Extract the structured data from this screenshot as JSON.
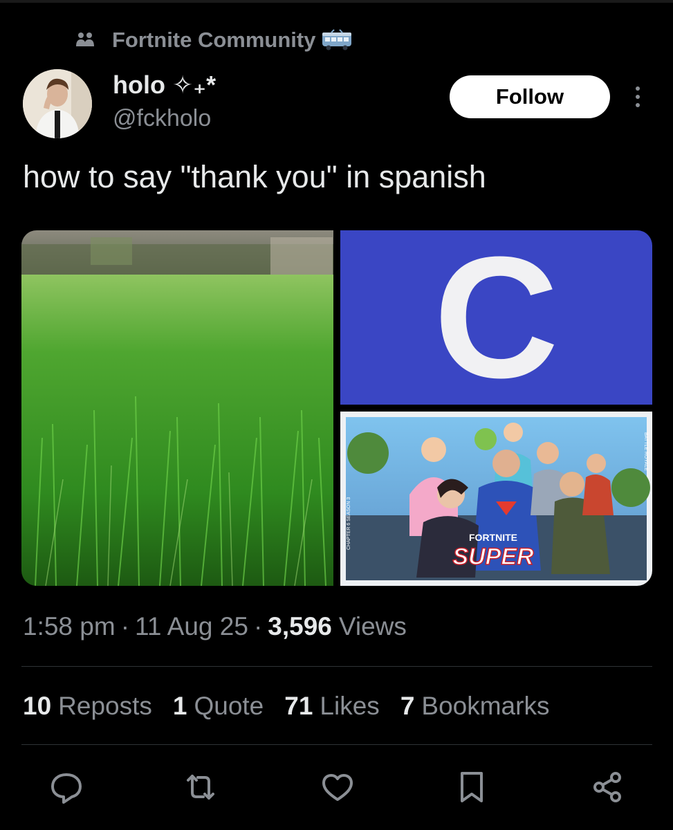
{
  "community": {
    "name": "Fortnite Community",
    "icon": "people-icon",
    "badge_icon": "bus-icon"
  },
  "author": {
    "display_name": "holo ✧₊*",
    "handle": "@fckholo",
    "avatar_icon": "avatar"
  },
  "follow_label": "Follow",
  "more_icon": "more-vertical-icon",
  "tweet_text": "how to say \"thank you\" in spanish",
  "media": {
    "tile1": "grass photo",
    "tile2_letter": "C",
    "tile3_logo": "FORTNITE",
    "tile3_title": "SUPER",
    "tile3_side_left": "CHAPTER 6 SEASON 3",
    "tile3_side_right": "BATTLE ROYALE",
    "colors": {
      "c_background": "#3a46c4",
      "grass": "#3f9a2b"
    }
  },
  "meta": {
    "time": "1:58 pm",
    "date": "11 Aug 25",
    "views_count": "3,596",
    "views_label": "Views"
  },
  "stats": {
    "reposts_count": "10",
    "reposts_label": "Reposts",
    "quotes_count": "1",
    "quotes_label": "Quote",
    "likes_count": "71",
    "likes_label": "Likes",
    "bookmarks_count": "7",
    "bookmarks_label": "Bookmarks"
  },
  "actions": [
    "reply-icon",
    "repost-icon",
    "like-icon",
    "bookmark-icon",
    "share-icon"
  ]
}
